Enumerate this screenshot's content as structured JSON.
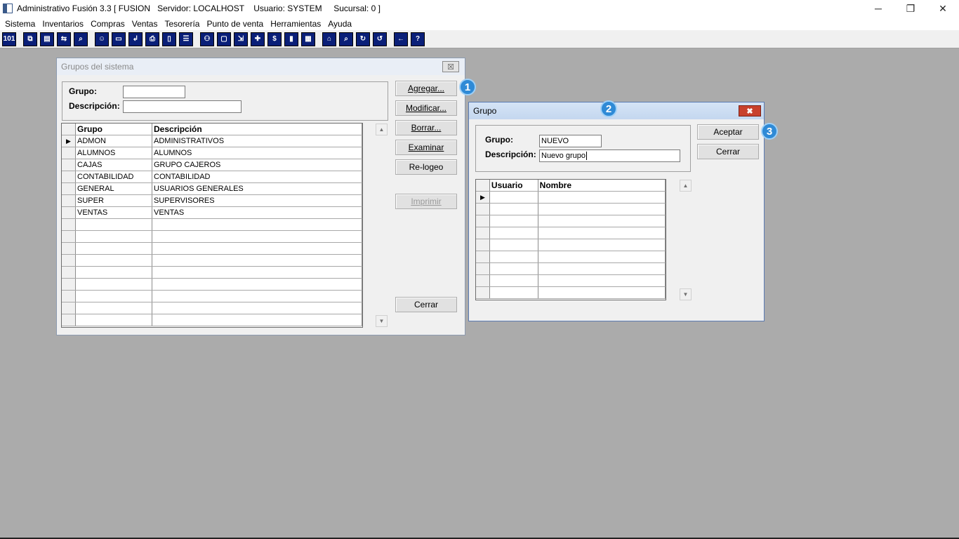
{
  "window": {
    "title": "Administrativo Fusión 3.3 [ FUSION   Servidor: LOCALHOST    Usuario: SYSTEM     Sucursal: 0 ]",
    "minimize": "─",
    "restore": "❐",
    "close": "✕"
  },
  "menu": [
    "Sistema",
    "Inventarios",
    "Compras",
    "Ventas",
    "Tesorería",
    "Punto de venta",
    "Herramientas",
    "Ayuda"
  ],
  "toolbar": {
    "groups": [
      [
        "calc-icon"
      ],
      [
        "copy-icon",
        "clipboard-icon",
        "exchange-icon",
        "search-doc-icon"
      ],
      [
        "user-icon",
        "folder-icon",
        "import-icon",
        "print-icon",
        "document-icon",
        "list-icon"
      ],
      [
        "users-icon",
        "box-icon",
        "export-icon",
        "add-icon",
        "dollar-icon",
        "report-icon",
        "table-icon"
      ],
      [
        "home-icon",
        "zoom-icon",
        "refresh-icon",
        "undo-icon"
      ],
      [
        "back-icon",
        "help-icon"
      ]
    ],
    "glyphs": {
      "calc-icon": "101",
      "copy-icon": "⧉",
      "clipboard-icon": "▤",
      "exchange-icon": "⇆",
      "search-doc-icon": "⌕",
      "user-icon": "☺",
      "folder-icon": "▭",
      "import-icon": "↲",
      "print-icon": "⎙",
      "document-icon": "▯",
      "list-icon": "☰",
      "users-icon": "⚇",
      "box-icon": "▢",
      "export-icon": "⇲",
      "add-icon": "✚",
      "dollar-icon": "$",
      "report-icon": "▮",
      "table-icon": "▦",
      "home-icon": "⌂",
      "zoom-icon": "⌕",
      "refresh-icon": "↻",
      "undo-icon": "↺",
      "back-icon": "←",
      "help-icon": "?"
    }
  },
  "groups_dialog": {
    "title": "Grupos del sistema",
    "close_glyph": "☒",
    "group_label": "Grupo:",
    "group_value": "",
    "description_label": "Descripción:",
    "description_value": "",
    "columns": [
      "Grupo",
      "Descripción"
    ],
    "rows": [
      {
        "grupo": "ADMON",
        "descripcion": "ADMINISTRATIVOS"
      },
      {
        "grupo": "ALUMNOS",
        "descripcion": "ALUMNOS"
      },
      {
        "grupo": "CAJAS",
        "descripcion": "GRUPO CAJEROS"
      },
      {
        "grupo": "CONTABILIDAD",
        "descripcion": "CONTABILIDAD"
      },
      {
        "grupo": "GENERAL",
        "descripcion": "USUARIOS GENERALES"
      },
      {
        "grupo": "SUPER",
        "descripcion": "SUPERVISORES"
      },
      {
        "grupo": "VENTAS",
        "descripcion": "VENTAS"
      }
    ],
    "empty_rows": 9,
    "current_row_marker": "▶",
    "buttons": {
      "add": "Agregar...",
      "modify": "Modificar...",
      "delete": "Borrar...",
      "examine": "Examinar",
      "relog": "Re-logeo",
      "print": "Imprimir",
      "close": "Cerrar"
    },
    "scroll_up": "▲",
    "scroll_down": "▼"
  },
  "group_dialog": {
    "title": "Grupo",
    "close_glyph": "✖",
    "group_label": "Grupo:",
    "group_value": "NUEVO",
    "description_label": "Descripción:",
    "description_value": "Nuevo grupo",
    "columns": [
      "Usuario",
      "Nombre"
    ],
    "empty_rows": 9,
    "current_row_marker": "▶",
    "buttons": {
      "accept": "Aceptar",
      "close": "Cerrar"
    },
    "scroll_up": "▲",
    "scroll_down": "▼"
  },
  "annotations": {
    "step1": "1",
    "step2": "2",
    "step3": "3"
  }
}
